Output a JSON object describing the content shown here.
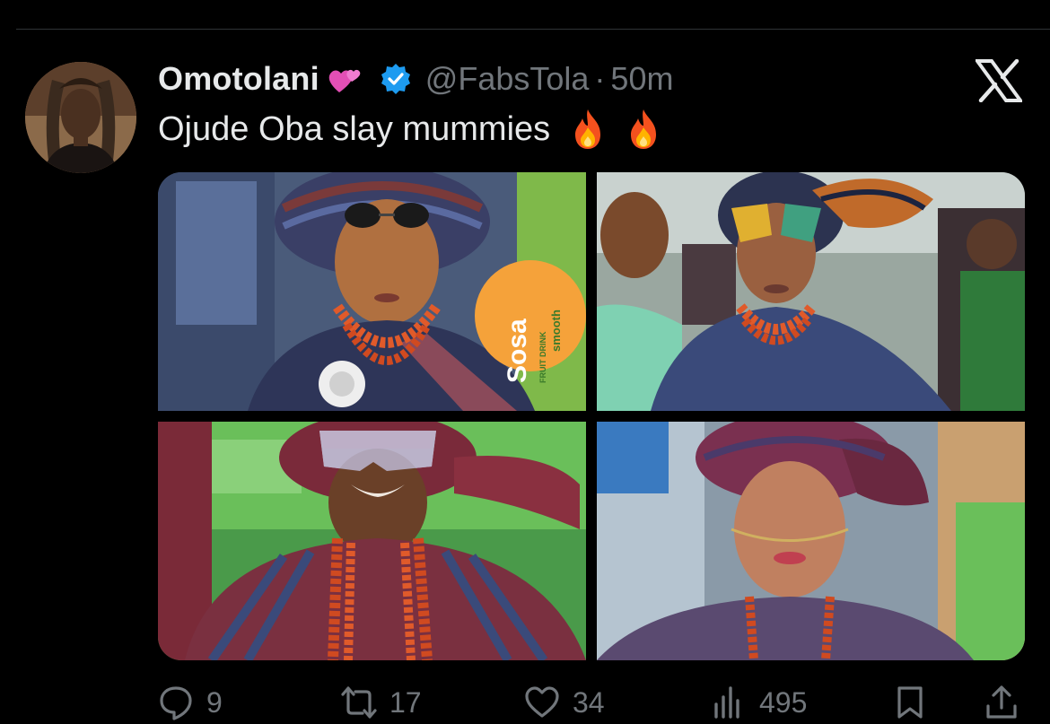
{
  "tweet": {
    "display_name": "Omotolani",
    "name_emoji": "two-hearts-emoji",
    "verified": true,
    "handle": "@FabsTola",
    "separator": "·",
    "time": "50m",
    "text": "Ojude Oba slay mummies",
    "text_emojis": [
      "fire-emoji",
      "fire-emoji"
    ]
  },
  "media": {
    "count": 4,
    "photos": [
      {
        "name": "photo-1",
        "overlay_text": "Sosa",
        "overlay_subtext": "FRUIT DRINK",
        "overlay_side": "smooth"
      },
      {
        "name": "photo-2"
      },
      {
        "name": "photo-3"
      },
      {
        "name": "photo-4"
      }
    ]
  },
  "actions": {
    "reply": {
      "icon": "reply-icon",
      "count": "9"
    },
    "repost": {
      "icon": "repost-icon",
      "count": "17"
    },
    "like": {
      "icon": "heart-icon",
      "count": "34"
    },
    "views": {
      "icon": "views-icon",
      "count": "495"
    },
    "bookmark": {
      "icon": "bookmark-icon"
    },
    "share": {
      "icon": "share-icon"
    }
  },
  "colors": {
    "background": "#000000",
    "text_primary": "#e7e9ea",
    "text_secondary": "#71767b",
    "verified_blue": "#1d9bf0"
  }
}
